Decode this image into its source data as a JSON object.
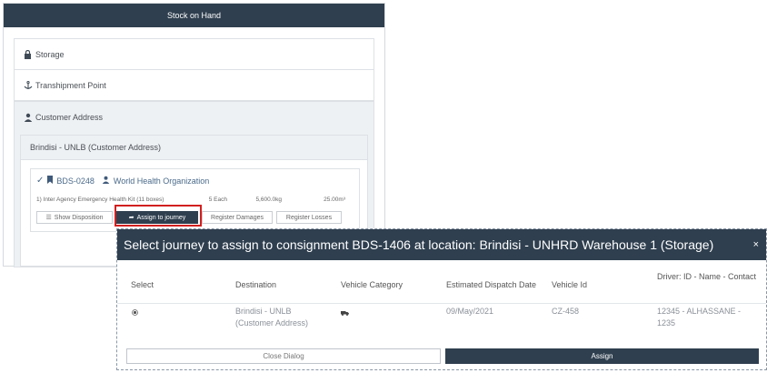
{
  "stock_panel": {
    "title": "Stock on Hand",
    "sections": {
      "storage": "Storage",
      "transhipment": "Transhipment Point",
      "customer": "Customer Address"
    },
    "location": "Brindisi - UNLB (Customer Address)",
    "consignment": {
      "id": "BDS-0248",
      "organization": "World Health Organization",
      "item": "1) Inter Agency Emergency Health Kit (11 boxes)",
      "quantity": "5 Each",
      "weight": "5,600.0kg",
      "volume": "25.00m³"
    },
    "buttons": {
      "show_disposition": "Show Disposition",
      "assign_to_journey": "Assign to journey",
      "register_damages": "Register Damages",
      "register_losses": "Register Losses"
    }
  },
  "dialog": {
    "title": "Select journey to assign to consignment BDS-1406 at location: Brindisi - UNHRD Warehouse 1 (Storage)",
    "close_symbol": "×",
    "columns": {
      "select": "Select",
      "destination": "Destination",
      "vehicle_category": "Vehicle Category",
      "dispatch_date": "Estimated Dispatch Date",
      "vehicle_id": "Vehicle Id",
      "driver": "Driver: ID - Name - Contact"
    },
    "rows": [
      {
        "destination": "Brindisi - UNLB (Customer Address)",
        "dispatch_date": "09/May/2021",
        "vehicle_id": "CZ-458",
        "driver": "12345 - ALHASSANE - 1235"
      }
    ],
    "close_dialog_label": "Close Dialog",
    "assign_label": "Assign"
  }
}
